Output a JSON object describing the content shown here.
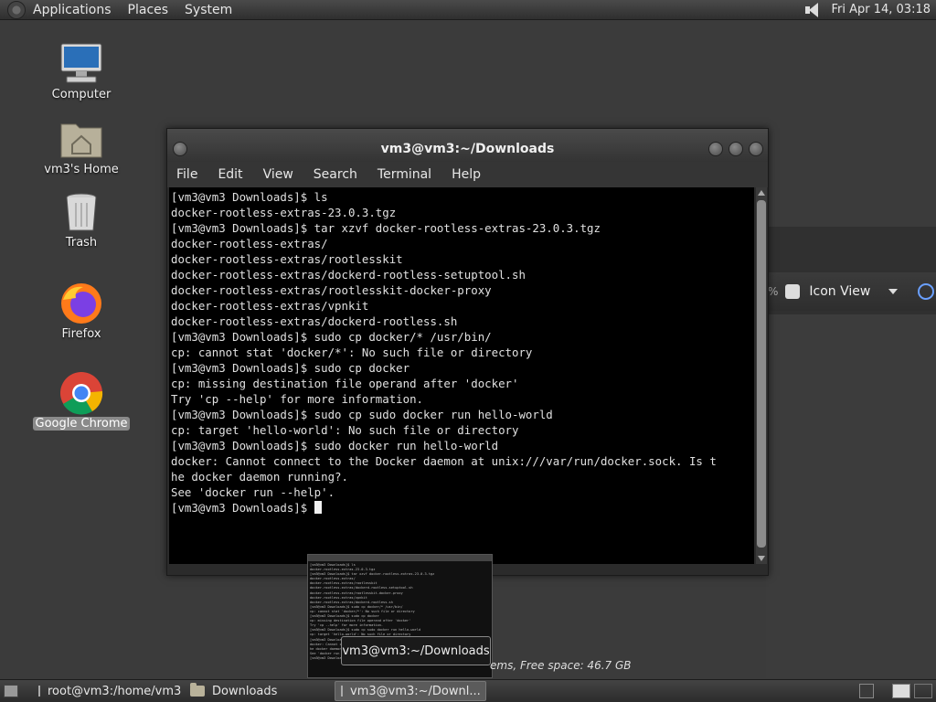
{
  "top_panel": {
    "menus": [
      "Applications",
      "Places",
      "System"
    ],
    "clock": "Fri Apr 14, 03:18"
  },
  "desktop": {
    "icons": [
      {
        "label": "Computer",
        "icon": "computer-icon"
      },
      {
        "label": "vm3's Home",
        "icon": "home-folder-icon"
      },
      {
        "label": "Trash",
        "icon": "trash-icon"
      },
      {
        "label": "Firefox",
        "icon": "firefox-icon"
      },
      {
        "label": "Google Chrome",
        "icon": "chrome-icon",
        "selected": true
      }
    ]
  },
  "back_window": {
    "view_mode": "Icon View",
    "status": "ems, Free space: 46.7 GB",
    "title_fragment": "root@vm3:/home/vm3"
  },
  "terminal": {
    "title": "vm3@vm3:~/Downloads",
    "menus": [
      "File",
      "Edit",
      "View",
      "Search",
      "Terminal",
      "Help"
    ],
    "lines": [
      "[vm3@vm3 Downloads]$ ls",
      "docker-rootless-extras-23.0.3.tgz",
      "[vm3@vm3 Downloads]$ tar xzvf docker-rootless-extras-23.0.3.tgz",
      "docker-rootless-extras/",
      "docker-rootless-extras/rootlesskit",
      "docker-rootless-extras/dockerd-rootless-setuptool.sh",
      "docker-rootless-extras/rootlesskit-docker-proxy",
      "docker-rootless-extras/vpnkit",
      "docker-rootless-extras/dockerd-rootless.sh",
      "[vm3@vm3 Downloads]$ sudo cp docker/* /usr/bin/",
      "cp: cannot stat 'docker/*': No such file or directory",
      "[vm3@vm3 Downloads]$ sudo cp docker",
      "cp: missing destination file operand after 'docker'",
      "Try 'cp --help' for more information.",
      "[vm3@vm3 Downloads]$ sudo cp sudo docker run hello-world",
      "cp: target 'hello-world': No such file or directory",
      "[vm3@vm3 Downloads]$ sudo docker run hello-world",
      "docker: Cannot connect to the Docker daemon at unix:///var/run/docker.sock. Is t",
      "he docker daemon running?.",
      "See 'docker run --help'.",
      "[vm3@vm3 Downloads]$ "
    ]
  },
  "preview": {
    "tooltip": "vm3@vm3:~/Downloads"
  },
  "taskbar": {
    "tasks": [
      {
        "label": "root@vm3:/home/vm3",
        "icon": "terminal-icon",
        "active": false
      },
      {
        "label": "Downloads",
        "icon": "folder-icon",
        "active": false
      },
      {
        "label": "vm3@vm3:~/Downl...",
        "icon": "terminal-icon",
        "active": true
      }
    ]
  }
}
